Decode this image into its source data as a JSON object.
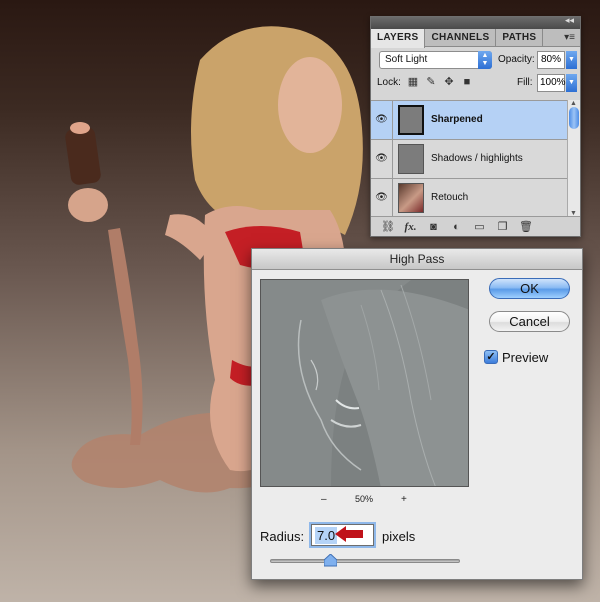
{
  "layers_panel": {
    "tabs": [
      "LAYERS",
      "CHANNELS",
      "PATHS"
    ],
    "blend_mode": "Soft Light",
    "opacity_label": "Opacity:",
    "opacity_value": "80%",
    "lock_label": "Lock:",
    "fill_label": "Fill:",
    "fill_value": "100%",
    "layers": [
      {
        "name": "Sharpened",
        "selected": true
      },
      {
        "name": "Shadows / highlights",
        "selected": false
      },
      {
        "name": "Retouch",
        "selected": false
      }
    ],
    "bottom_icons": [
      "link-icon",
      "fx-icon",
      "mask-icon",
      "adjustment-icon",
      "group-icon",
      "new-layer-icon",
      "trash-icon"
    ],
    "fx_glyph": "fx."
  },
  "high_pass": {
    "title": "High Pass",
    "ok_label": "OK",
    "cancel_label": "Cancel",
    "preview_label": "Preview",
    "preview_checked": true,
    "zoom_minus": "–",
    "zoom_level": "50%",
    "zoom_plus": "+",
    "radius_label": "Radius:",
    "radius_value": "7.0",
    "radius_unit": "pixels"
  },
  "colors": {
    "accent_blue": "#5b9be8",
    "selected_row": "#b5d1f5",
    "arrow_red": "#c0121a"
  }
}
